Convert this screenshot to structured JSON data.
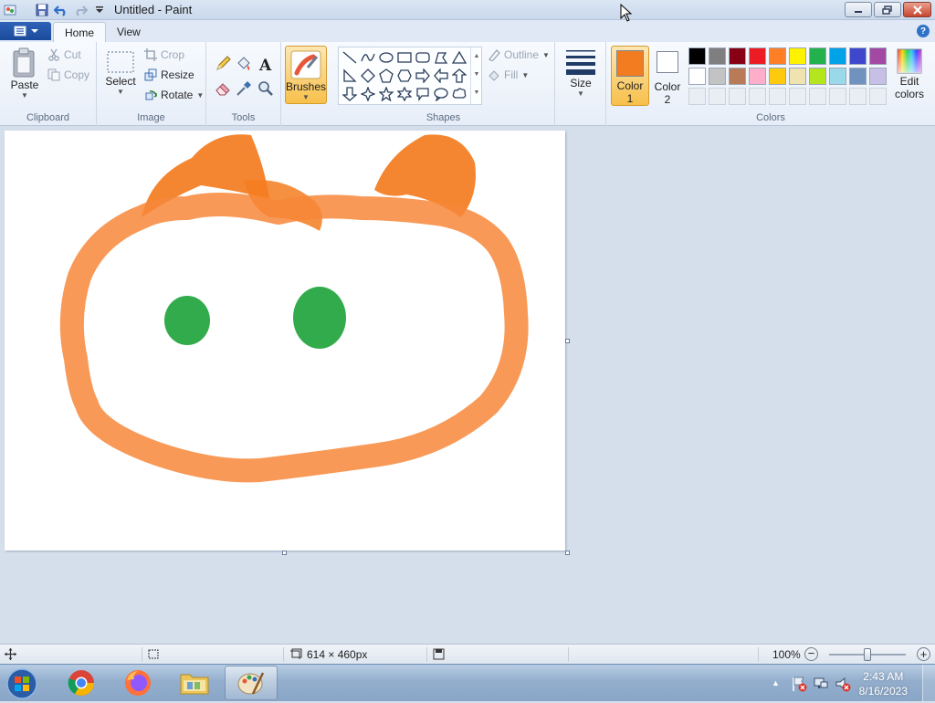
{
  "window": {
    "title": "Untitled - Paint"
  },
  "tabs": {
    "home": "Home",
    "view": "View"
  },
  "clipboard": {
    "paste": "Paste",
    "cut": "Cut",
    "copy": "Copy",
    "label": "Clipboard"
  },
  "image": {
    "select": "Select",
    "crop": "Crop",
    "resize": "Resize",
    "rotate": "Rotate",
    "label": "Image"
  },
  "tools": {
    "label": "Tools"
  },
  "brushes": {
    "label": "Brushes"
  },
  "shapes": {
    "outline": "Outline",
    "fill": "Fill",
    "label": "Shapes"
  },
  "size": {
    "label": "Size"
  },
  "colors": {
    "color1_line1": "Color",
    "color1_line2": "1",
    "color2_line1": "Color",
    "color2_line2": "2",
    "edit_line1": "Edit",
    "edit_line2": "colors",
    "label": "Colors",
    "color1": "#f47c20",
    "color2": "#ffffff",
    "palette_row1": [
      "#000000",
      "#7f7f7f",
      "#880015",
      "#ed1c24",
      "#ff7f27",
      "#fff200",
      "#22b14c",
      "#00a2e8",
      "#3f48cc",
      "#a349a4"
    ],
    "palette_row2": [
      "#ffffff",
      "#c3c3c3",
      "#b97a57",
      "#ffaec9",
      "#ffc90e",
      "#efe4b0",
      "#b5e61d",
      "#99d9ea",
      "#7092be",
      "#c8bfe7"
    ]
  },
  "status": {
    "dimensions": "614 × 460px",
    "zoom": "100%"
  },
  "taskbar": {
    "time": "2:43 AM",
    "date": "8/16/2023"
  }
}
